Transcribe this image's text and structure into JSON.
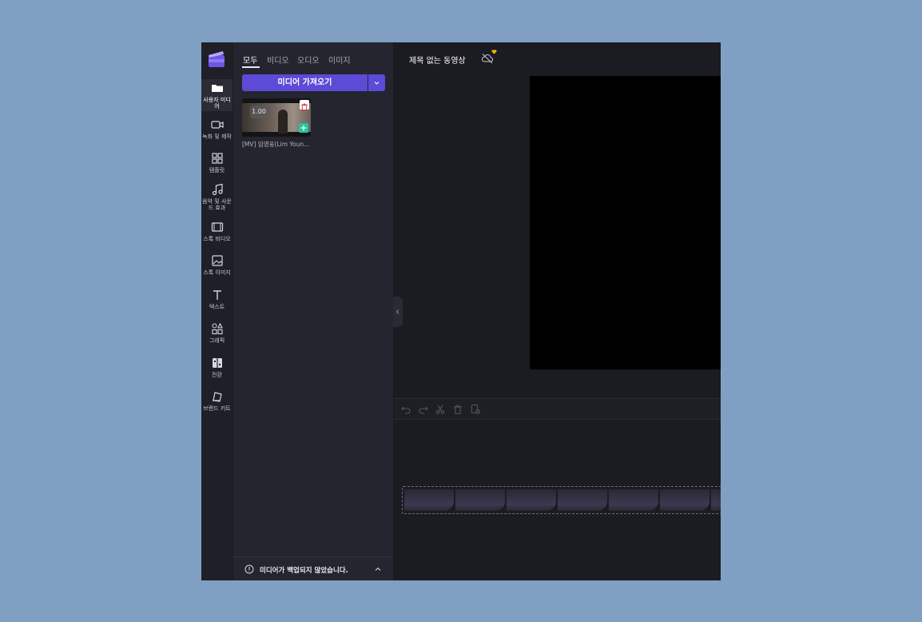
{
  "nav": {
    "items": [
      {
        "label": "사용자 미디어",
        "icon": "folder-icon"
      },
      {
        "label": "녹화 및 제작",
        "icon": "video-camera-icon"
      },
      {
        "label": "템플릿",
        "icon": "template-grid-icon"
      },
      {
        "label": "음악 및 사운드 효과",
        "icon": "music-note-icon"
      },
      {
        "label": "스톡 비디오",
        "icon": "film-icon"
      },
      {
        "label": "스톡 이미지",
        "icon": "image-icon"
      },
      {
        "label": "텍스트",
        "icon": "text-icon"
      },
      {
        "label": "그래픽",
        "icon": "shapes-icon"
      },
      {
        "label": "전환",
        "icon": "transition-icon"
      },
      {
        "label": "브랜드 키트",
        "icon": "brand-kit-icon"
      }
    ]
  },
  "panel": {
    "tabs": [
      "모두",
      "비디오",
      "오디오",
      "이미지"
    ],
    "import_label": "미디어 가져오기",
    "media": [
      {
        "duration": "1.00",
        "name": "[MV] 임영웅(Lim Youn..."
      }
    ],
    "backup_message": "미디어가 백업되지 않았습니다."
  },
  "main": {
    "title": "제목 없는 동영상"
  },
  "colors": {
    "accent": "#5b4bd6",
    "add_green": "#1fc79a",
    "premium_gold": "#f0b400"
  }
}
